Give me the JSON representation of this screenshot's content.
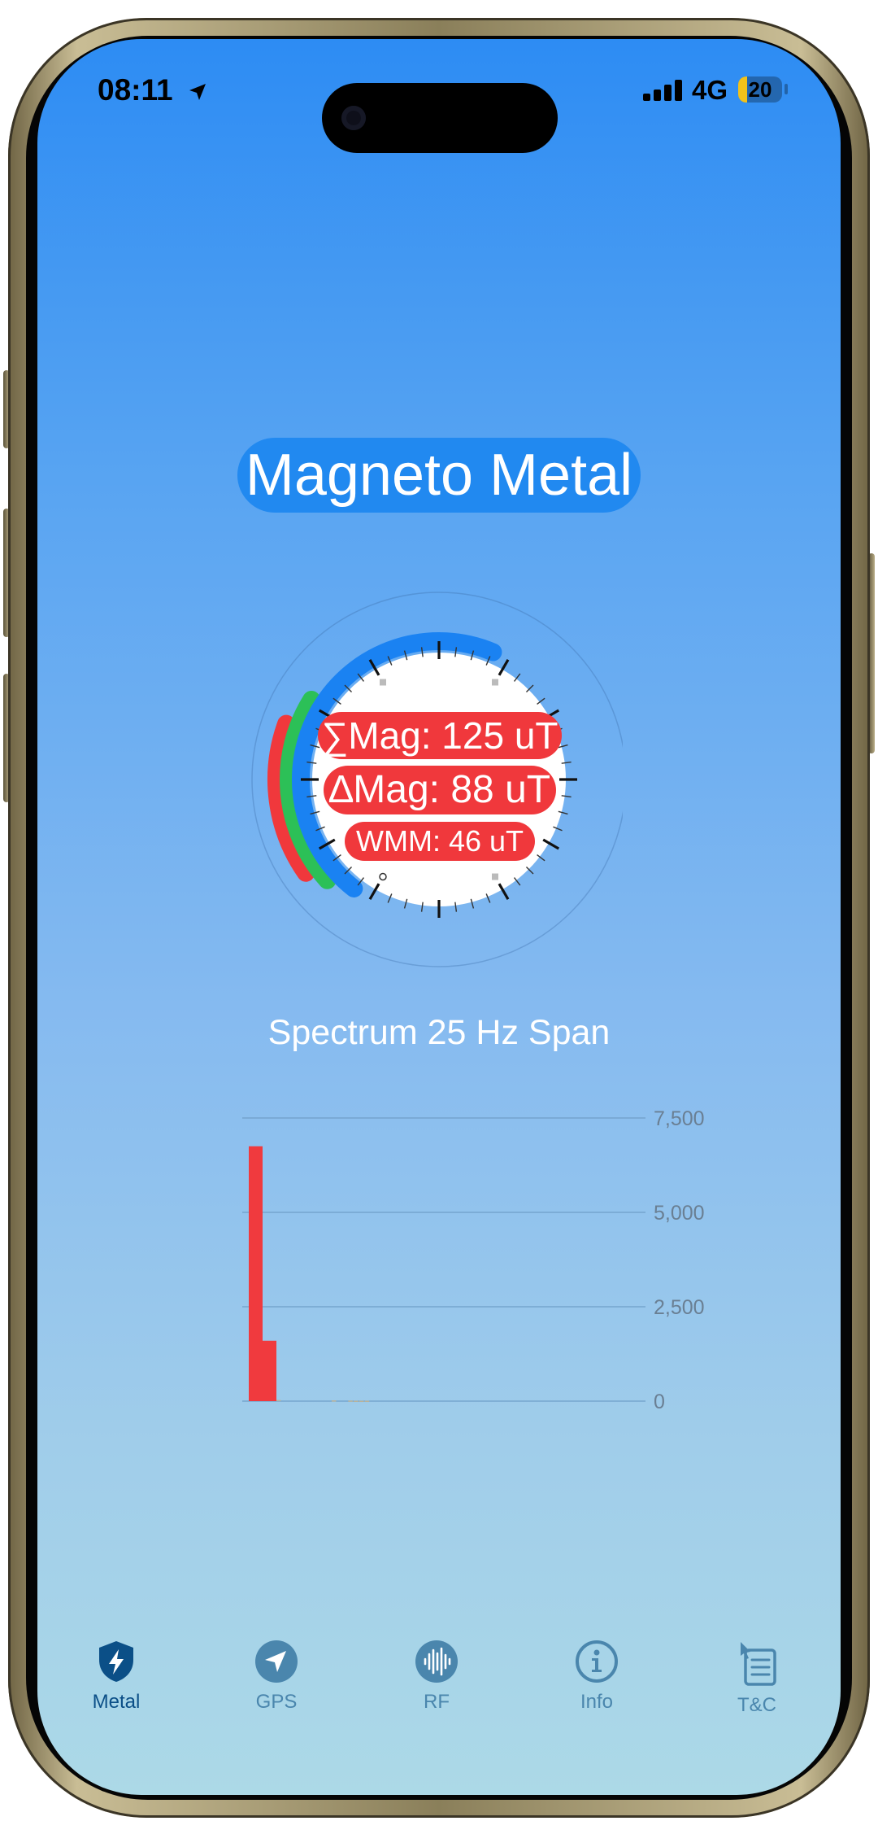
{
  "status_bar": {
    "time": "08:11",
    "network": "4G",
    "battery": "20",
    "battery_level": 0.2,
    "signal_bars": 4
  },
  "app": {
    "title": "Magneto Metal"
  },
  "readouts": {
    "sum_mag": "∑Mag: 125 uT",
    "delta_mag": "∆Mag: 88 uT",
    "wmm": "WMM: 46 uT"
  },
  "spectrum": {
    "title": "Spectrum 25 Hz Span"
  },
  "chart_data": {
    "type": "bar",
    "title": "Spectrum 25 Hz Span",
    "xlabel": "",
    "ylabel": "",
    "ylim": [
      0,
      7500
    ],
    "yticks": [
      "7,500",
      "5,000",
      "2,500",
      "0"
    ],
    "ytick_values": [
      7500,
      5000,
      2500,
      0
    ],
    "grid": true,
    "values": [
      6750,
      1600,
      30,
      0,
      0,
      0,
      0,
      0,
      0,
      0,
      0,
      0,
      20,
      0,
      0,
      15,
      10,
      10,
      10,
      0,
      0,
      0,
      0,
      0,
      0,
      0,
      0,
      0,
      0,
      0,
      0,
      0,
      0,
      0,
      0,
      0,
      0,
      0,
      0,
      0,
      0,
      0,
      0,
      0,
      0,
      0,
      0,
      0,
      0,
      0,
      0,
      0,
      0,
      0,
      0,
      0,
      0,
      0,
      0,
      0,
      0,
      0,
      0,
      0,
      0,
      0,
      0,
      0,
      0,
      0,
      0,
      0,
      0,
      0,
      0,
      0,
      0,
      0,
      0,
      0,
      0,
      0,
      0,
      0,
      0,
      0,
      0,
      0,
      0,
      0,
      0,
      0,
      0,
      0,
      0,
      0,
      0,
      0,
      0,
      0,
      0,
      0,
      0,
      0,
      0,
      0,
      0
    ],
    "bar_color": "#f03a3e",
    "grid_color": "#6f9ec8"
  },
  "gauge": {
    "blue_arc_color": "#1a82f2",
    "green_arc_color": "#2cc057",
    "red_arc_color": "#f0383c"
  },
  "tabs": [
    {
      "label": "Metal",
      "icon": "shield-bolt-icon",
      "active": true
    },
    {
      "label": "GPS",
      "icon": "navigation-arrow-icon",
      "active": false
    },
    {
      "label": "RF",
      "icon": "waveform-icon",
      "active": false
    },
    {
      "label": "Info",
      "icon": "info-circle-icon",
      "active": false
    },
    {
      "label": "T&C",
      "icon": "document-list-icon",
      "active": false
    }
  ],
  "colors": {
    "accent": "#2189f0",
    "active_tab": "#0b4f87",
    "inactive_tab": "#4a86ad"
  }
}
